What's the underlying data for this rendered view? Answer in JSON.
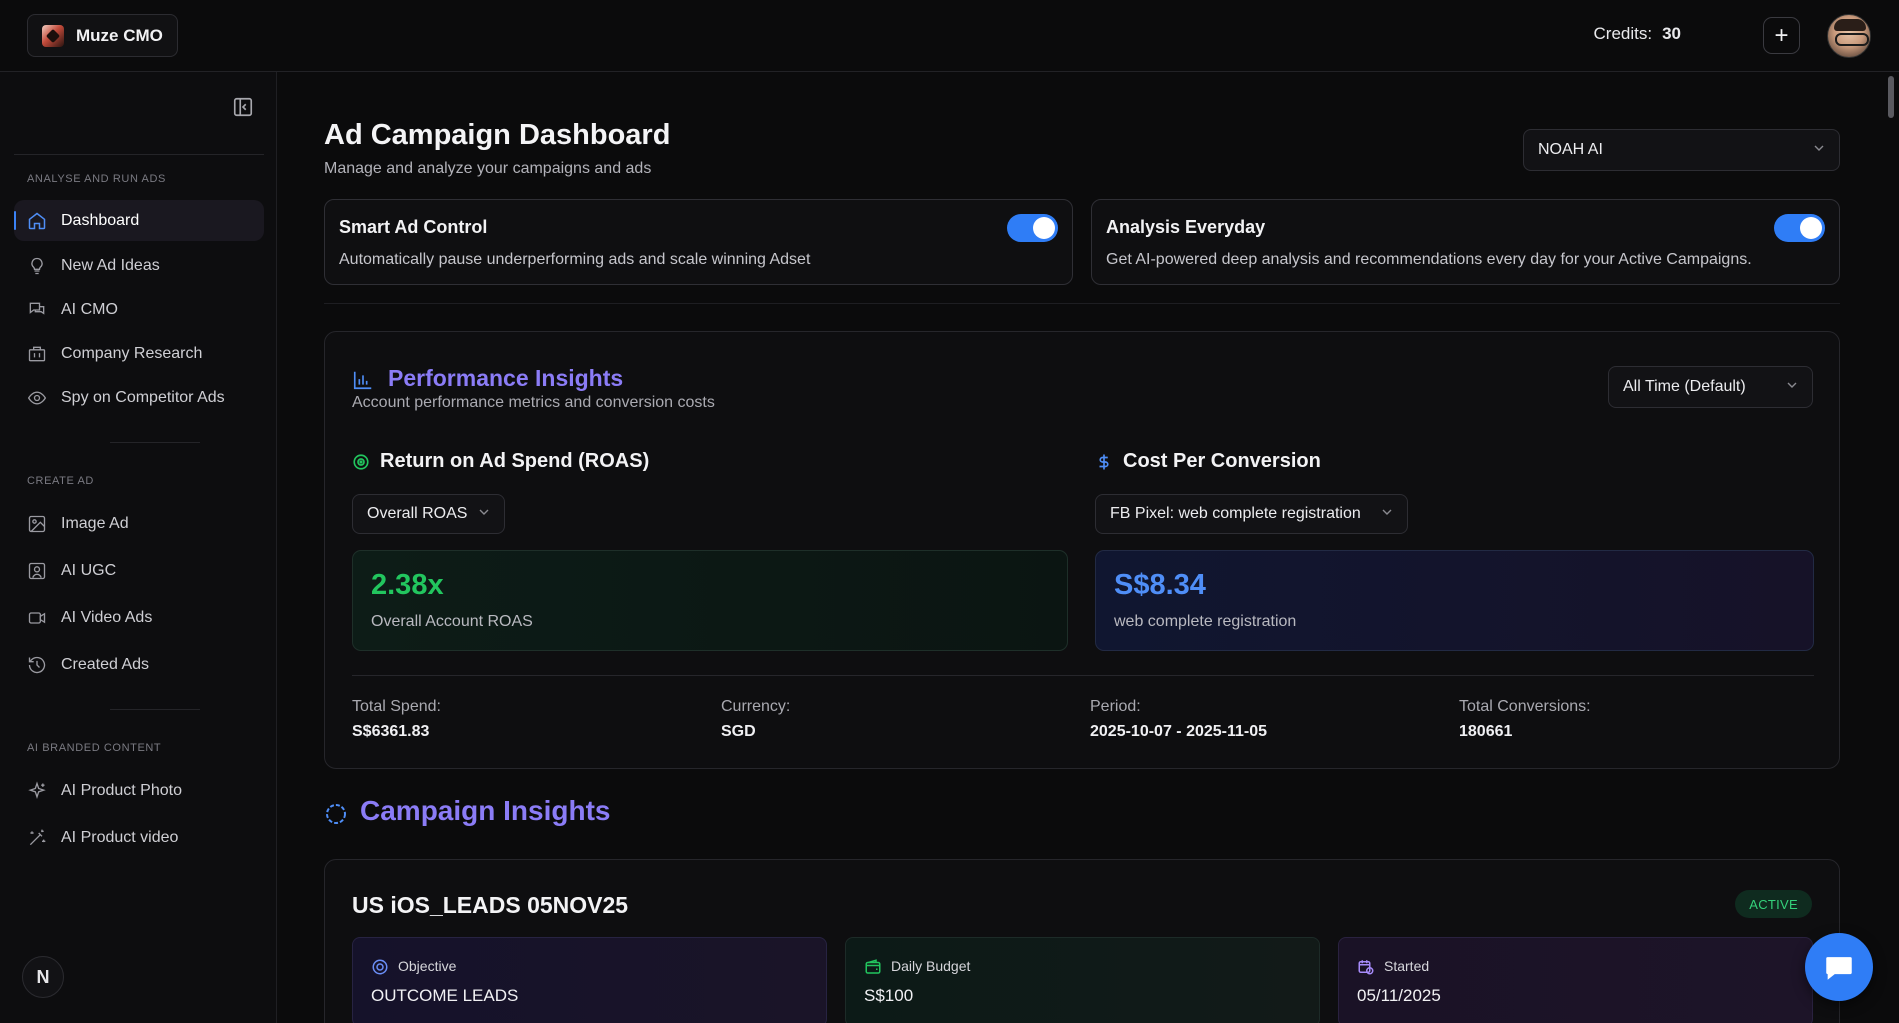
{
  "brand": {
    "name": "Muze CMO"
  },
  "header": {
    "credits_label": "Credits:",
    "credits_value": "30",
    "add_label": "+"
  },
  "sidebar": {
    "sections": [
      {
        "title": "ANALYSE AND RUN ADS"
      },
      {
        "title": "CREATE AD"
      },
      {
        "title": "AI BRANDED CONTENT"
      }
    ],
    "items": [
      {
        "label": "Dashboard",
        "icon": "home-icon",
        "active": true
      },
      {
        "label": "New Ad Ideas",
        "icon": "lightbulb-icon"
      },
      {
        "label": "AI CMO",
        "icon": "chat-icon"
      },
      {
        "label": "Company Research",
        "icon": "building-icon"
      },
      {
        "label": "Spy on Competitor Ads",
        "icon": "eye-icon"
      },
      {
        "label": "Image Ad",
        "icon": "image-icon"
      },
      {
        "label": "AI UGC",
        "icon": "user-square-icon"
      },
      {
        "label": "AI Video Ads",
        "icon": "video-icon"
      },
      {
        "label": "Created Ads",
        "icon": "history-icon"
      },
      {
        "label": "AI Product Photo",
        "icon": "sparkles-icon"
      },
      {
        "label": "AI Product video",
        "icon": "magic-wand-icon"
      }
    ],
    "footer_badge": "N"
  },
  "page": {
    "title": "Ad Campaign Dashboard",
    "subtitle": "Manage and analyze your campaigns and ads",
    "account_select": "NOAH AI"
  },
  "toggles": [
    {
      "title": "Smart Ad Control",
      "desc": "Automatically pause underperforming ads and scale winning Adset",
      "on": true
    },
    {
      "title": "Analysis Everyday",
      "desc": "Get AI-powered deep analysis and recommendations every day for your Active Campaigns.",
      "on": true
    }
  ],
  "performance": {
    "title": "Performance Insights",
    "subtitle": "Account performance metrics and conversion costs",
    "range_select": "All Time (Default)",
    "roas": {
      "heading": "Return on Ad Spend (ROAS)",
      "select": "Overall ROAS",
      "value": "2.38x",
      "label": "Overall Account ROAS"
    },
    "cpc": {
      "heading": "Cost Per Conversion",
      "select": "FB Pixel: web complete registration",
      "value": "S$8.34",
      "label": "web complete registration"
    },
    "stats": [
      {
        "k": "Total Spend:",
        "v": "S$6361.83"
      },
      {
        "k": "Currency:",
        "v": "SGD"
      },
      {
        "k": "Period:",
        "v": "2025-10-07 - 2025-11-05"
      },
      {
        "k": "Total Conversions:",
        "v": "180661"
      }
    ]
  },
  "campaign_insights": {
    "title": "Campaign Insights",
    "campaign": {
      "name": "US iOS_LEADS 05NOV25",
      "status": "ACTIVE",
      "objective_label": "Objective",
      "objective_value": "OUTCOME LEADS",
      "budget_label": "Daily Budget",
      "budget_value": "S$100",
      "started_label": "Started",
      "started_value": "05/11/2025"
    }
  },
  "colors": {
    "accent": "#2f7df6",
    "heading_purple": "#8b7cf6",
    "roas_green": "#22c55e",
    "cpc_blue": "#4f8ef7",
    "active_green": "#34d17a"
  }
}
